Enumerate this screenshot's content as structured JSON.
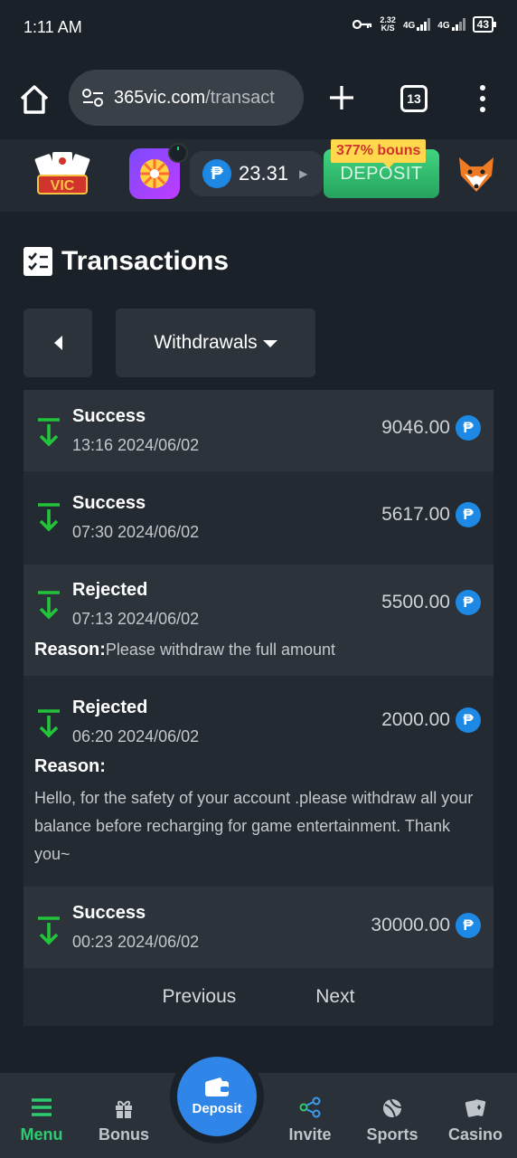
{
  "status_bar": {
    "time": "1:11 AM",
    "speed_value": "2.32",
    "speed_unit": "K/S",
    "net1": "4G",
    "net2": "4G",
    "battery": "43"
  },
  "browser": {
    "url_host": "365vic.com",
    "url_path": "/transact",
    "tab_count": "13"
  },
  "header": {
    "balance": "23.31",
    "deposit_label": "DEPOSIT",
    "bonus_tag": "377% bouns",
    "currency_symbol": "₱",
    "logo_text": "VIC"
  },
  "page": {
    "title": "Transactions",
    "filter_selected": "Withdrawals"
  },
  "transactions": [
    {
      "status": "Success",
      "time": "13:16 2024/06/02",
      "amount": "9046.00"
    },
    {
      "status": "Success",
      "time": "07:30 2024/06/02",
      "amount": "5617.00"
    },
    {
      "status": "Rejected",
      "time": "07:13 2024/06/02",
      "amount": "5500.00",
      "reason_label": "Reason:",
      "reason": "Please withdraw the full amount"
    },
    {
      "status": "Rejected",
      "time": "06:20 2024/06/02",
      "amount": "2000.00",
      "reason_label": "Reason:",
      "reason": "Hello, for the safety of your account .please withdraw all your balance before recharging for game entertainment. Thank you~"
    },
    {
      "status": "Success",
      "time": "00:23 2024/06/02",
      "amount": "30000.00"
    }
  ],
  "pager": {
    "previous": "Previous",
    "next": "Next"
  },
  "nav": {
    "menu": "Menu",
    "bonus": "Bonus",
    "deposit": "Deposit",
    "invite": "Invite",
    "sports": "Sports",
    "casino": "Casino"
  },
  "colors": {
    "success_arrow": "#22c53a",
    "accent_green": "#2ecc71",
    "peso_blue": "#1e88e5",
    "deposit_blue": "#2f86e8"
  }
}
